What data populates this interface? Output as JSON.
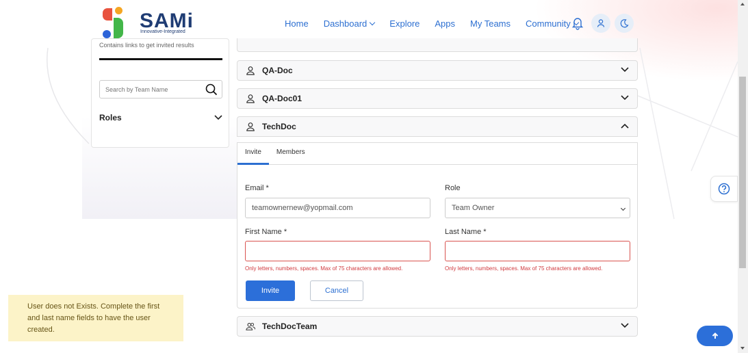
{
  "brand": {
    "name": "SAMi",
    "tagline": "Innovative-Integrated",
    "colors": {
      "red": "#e8533f",
      "orange": "#f5a623",
      "blue": "#2d64d8",
      "green": "#43b649",
      "text": "#1f3c73"
    }
  },
  "nav": {
    "items": [
      {
        "label": "Home",
        "dropdown": false
      },
      {
        "label": "Dashboard",
        "dropdown": true
      },
      {
        "label": "Explore",
        "dropdown": false
      },
      {
        "label": "Apps",
        "dropdown": false
      },
      {
        "label": "My Teams",
        "dropdown": false
      },
      {
        "label": "Community",
        "dropdown": true
      }
    ],
    "icons": [
      "bell-icon",
      "user-icon",
      "moon-icon"
    ],
    "accent": "#2c6fd1"
  },
  "sidebar": {
    "cut_text": "Contains links to get invited results",
    "search": {
      "placeholder": "Search by Team Name",
      "value": ""
    },
    "roles_label": "Roles"
  },
  "teams": [
    {
      "name": "QA-Doc",
      "expanded": false,
      "icon": "user-icon"
    },
    {
      "name": "QA-Doc01",
      "expanded": false,
      "icon": "user-icon"
    },
    {
      "name": "TechDoc",
      "expanded": true,
      "icon": "user-icon"
    },
    {
      "name": "TechDocTeam",
      "expanded": false,
      "icon": "users-icon"
    }
  ],
  "invite_panel": {
    "tabs": [
      {
        "label": "Invite",
        "active": true
      },
      {
        "label": "Members",
        "active": false
      }
    ],
    "email": {
      "label": "Email *",
      "value": "teamownernew@yopmail.com"
    },
    "role": {
      "label": "Role",
      "value": "Team Owner"
    },
    "first_name": {
      "label": "First Name *",
      "value": "",
      "error": "Only letters, numbers, spaces. Max of 75 characters are allowed."
    },
    "last_name": {
      "label": "Last Name *",
      "value": "",
      "error": "Only letters, numbers, spaces. Max of 75 characters are allowed."
    },
    "invite_label": "Invite",
    "cancel_label": "Cancel"
  },
  "toast": {
    "message": "User does not Exists. Complete the first and last name fields to have the user created.",
    "color": "#fcf3c8"
  },
  "help_icon": "question-circle-icon",
  "scroll_top_icon": "arrow-up-icon"
}
